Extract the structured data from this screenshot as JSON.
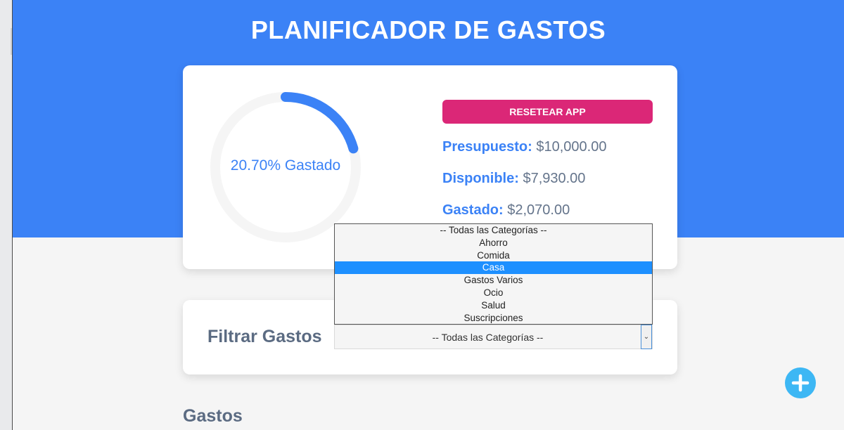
{
  "header": {
    "title": "PLANIFICADOR DE GASTOS"
  },
  "budget": {
    "percent_spent": 20.7,
    "progress_label": "20.70% Gastado",
    "reset_label": "RESETEAR APP",
    "stats": [
      {
        "label": "Presupuesto:",
        "value": "$10,000.00"
      },
      {
        "label": "Disponible:",
        "value": "$7,930.00"
      },
      {
        "label": "Gastado:",
        "value": "$2,070.00"
      }
    ]
  },
  "filter": {
    "label": "Filtrar Gastos",
    "selected_value": "-- Todas las Categorías --",
    "options": [
      "-- Todas las Categorías --",
      "Ahorro",
      "Comida",
      "Casa",
      "Gastos Varios",
      "Ocio",
      "Salud",
      "Suscripciones"
    ],
    "highlighted_option": "Casa"
  },
  "expenses": {
    "title": "Gastos"
  },
  "icons": {
    "add": "plus-icon",
    "dropdown_arrow": "chevron-down-icon"
  },
  "colors": {
    "primary": "#3b82f6",
    "reset_button": "#db2777",
    "add_button": "#3db7f4",
    "option_highlight": "#1e90ff",
    "track": "#f5f5f5"
  }
}
